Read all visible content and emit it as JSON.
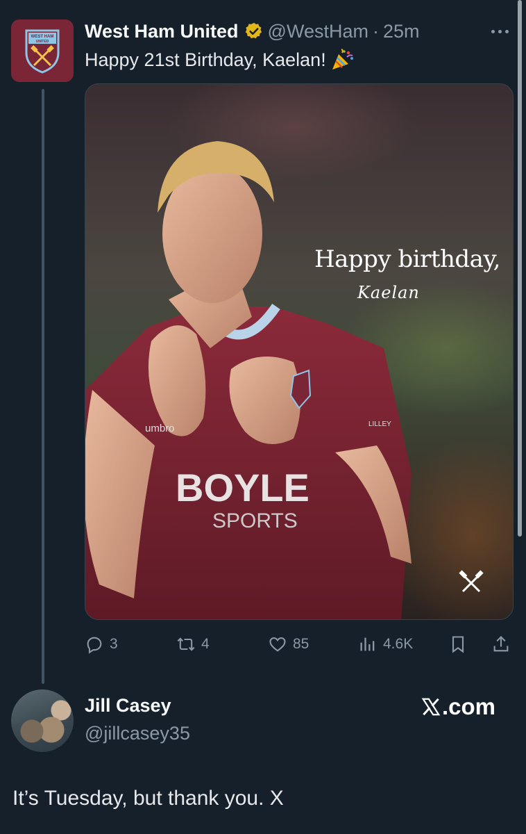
{
  "tweet": {
    "author_name": "West Ham United",
    "handle": "@WestHam",
    "separator": "·",
    "time": "25m",
    "text": "Happy 21st Birthday, Kaelan!",
    "emoji_icon": "party-popper-icon",
    "verified_badge_color": "#e2b719"
  },
  "media": {
    "overlay_title": "Happy birthday,",
    "overlay_name": "Kaelan",
    "shirt_sponsor": "BOYLE",
    "shirt_sponsor_sub": "SPORTS",
    "shirt_maker": "umbro",
    "sleeve_text": "LILLEY",
    "corner_icon": "crossed-hammers-icon"
  },
  "actions": {
    "replies": "3",
    "reposts": "4",
    "likes": "85",
    "views": "4.6K"
  },
  "reply": {
    "author_name": "Jill Casey",
    "handle": "@jillcasey35",
    "text": "It’s Tuesday, but thank you. X"
  },
  "watermark": {
    "text": ".com"
  },
  "colors": {
    "background": "#15202b",
    "club_claret": "#7a2636",
    "secondary_text": "#8b98a5",
    "thread_line": "#425364"
  }
}
